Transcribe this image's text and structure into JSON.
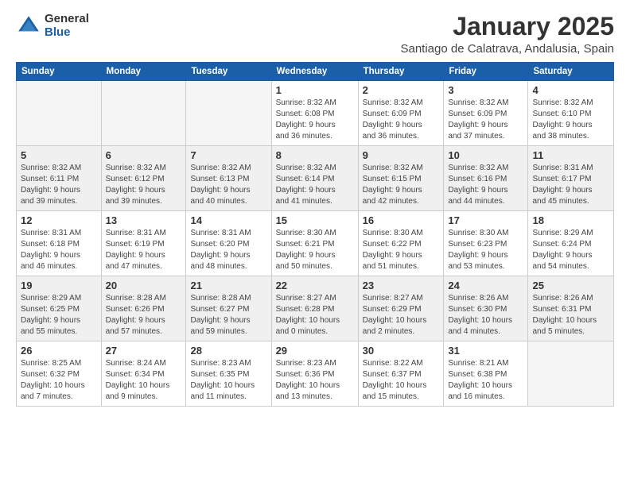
{
  "logo": {
    "general": "General",
    "blue": "Blue"
  },
  "title": "January 2025",
  "subtitle": "Santiago de Calatrava, Andalusia, Spain",
  "days_of_week": [
    "Sunday",
    "Monday",
    "Tuesday",
    "Wednesday",
    "Thursday",
    "Friday",
    "Saturday"
  ],
  "weeks": [
    [
      {
        "num": "",
        "info": "",
        "empty": true
      },
      {
        "num": "",
        "info": "",
        "empty": true
      },
      {
        "num": "",
        "info": "",
        "empty": true
      },
      {
        "num": "1",
        "info": "Sunrise: 8:32 AM\nSunset: 6:08 PM\nDaylight: 9 hours\nand 36 minutes.",
        "empty": false
      },
      {
        "num": "2",
        "info": "Sunrise: 8:32 AM\nSunset: 6:09 PM\nDaylight: 9 hours\nand 36 minutes.",
        "empty": false
      },
      {
        "num": "3",
        "info": "Sunrise: 8:32 AM\nSunset: 6:09 PM\nDaylight: 9 hours\nand 37 minutes.",
        "empty": false
      },
      {
        "num": "4",
        "info": "Sunrise: 8:32 AM\nSunset: 6:10 PM\nDaylight: 9 hours\nand 38 minutes.",
        "empty": false
      }
    ],
    [
      {
        "num": "5",
        "info": "Sunrise: 8:32 AM\nSunset: 6:11 PM\nDaylight: 9 hours\nand 39 minutes.",
        "empty": false
      },
      {
        "num": "6",
        "info": "Sunrise: 8:32 AM\nSunset: 6:12 PM\nDaylight: 9 hours\nand 39 minutes.",
        "empty": false
      },
      {
        "num": "7",
        "info": "Sunrise: 8:32 AM\nSunset: 6:13 PM\nDaylight: 9 hours\nand 40 minutes.",
        "empty": false
      },
      {
        "num": "8",
        "info": "Sunrise: 8:32 AM\nSunset: 6:14 PM\nDaylight: 9 hours\nand 41 minutes.",
        "empty": false
      },
      {
        "num": "9",
        "info": "Sunrise: 8:32 AM\nSunset: 6:15 PM\nDaylight: 9 hours\nand 42 minutes.",
        "empty": false
      },
      {
        "num": "10",
        "info": "Sunrise: 8:32 AM\nSunset: 6:16 PM\nDaylight: 9 hours\nand 44 minutes.",
        "empty": false
      },
      {
        "num": "11",
        "info": "Sunrise: 8:31 AM\nSunset: 6:17 PM\nDaylight: 9 hours\nand 45 minutes.",
        "empty": false
      }
    ],
    [
      {
        "num": "12",
        "info": "Sunrise: 8:31 AM\nSunset: 6:18 PM\nDaylight: 9 hours\nand 46 minutes.",
        "empty": false
      },
      {
        "num": "13",
        "info": "Sunrise: 8:31 AM\nSunset: 6:19 PM\nDaylight: 9 hours\nand 47 minutes.",
        "empty": false
      },
      {
        "num": "14",
        "info": "Sunrise: 8:31 AM\nSunset: 6:20 PM\nDaylight: 9 hours\nand 48 minutes.",
        "empty": false
      },
      {
        "num": "15",
        "info": "Sunrise: 8:30 AM\nSunset: 6:21 PM\nDaylight: 9 hours\nand 50 minutes.",
        "empty": false
      },
      {
        "num": "16",
        "info": "Sunrise: 8:30 AM\nSunset: 6:22 PM\nDaylight: 9 hours\nand 51 minutes.",
        "empty": false
      },
      {
        "num": "17",
        "info": "Sunrise: 8:30 AM\nSunset: 6:23 PM\nDaylight: 9 hours\nand 53 minutes.",
        "empty": false
      },
      {
        "num": "18",
        "info": "Sunrise: 8:29 AM\nSunset: 6:24 PM\nDaylight: 9 hours\nand 54 minutes.",
        "empty": false
      }
    ],
    [
      {
        "num": "19",
        "info": "Sunrise: 8:29 AM\nSunset: 6:25 PM\nDaylight: 9 hours\nand 55 minutes.",
        "empty": false
      },
      {
        "num": "20",
        "info": "Sunrise: 8:28 AM\nSunset: 6:26 PM\nDaylight: 9 hours\nand 57 minutes.",
        "empty": false
      },
      {
        "num": "21",
        "info": "Sunrise: 8:28 AM\nSunset: 6:27 PM\nDaylight: 9 hours\nand 59 minutes.",
        "empty": false
      },
      {
        "num": "22",
        "info": "Sunrise: 8:27 AM\nSunset: 6:28 PM\nDaylight: 10 hours\nand 0 minutes.",
        "empty": false
      },
      {
        "num": "23",
        "info": "Sunrise: 8:27 AM\nSunset: 6:29 PM\nDaylight: 10 hours\nand 2 minutes.",
        "empty": false
      },
      {
        "num": "24",
        "info": "Sunrise: 8:26 AM\nSunset: 6:30 PM\nDaylight: 10 hours\nand 4 minutes.",
        "empty": false
      },
      {
        "num": "25",
        "info": "Sunrise: 8:26 AM\nSunset: 6:31 PM\nDaylight: 10 hours\nand 5 minutes.",
        "empty": false
      }
    ],
    [
      {
        "num": "26",
        "info": "Sunrise: 8:25 AM\nSunset: 6:32 PM\nDaylight: 10 hours\nand 7 minutes.",
        "empty": false
      },
      {
        "num": "27",
        "info": "Sunrise: 8:24 AM\nSunset: 6:34 PM\nDaylight: 10 hours\nand 9 minutes.",
        "empty": false
      },
      {
        "num": "28",
        "info": "Sunrise: 8:23 AM\nSunset: 6:35 PM\nDaylight: 10 hours\nand 11 minutes.",
        "empty": false
      },
      {
        "num": "29",
        "info": "Sunrise: 8:23 AM\nSunset: 6:36 PM\nDaylight: 10 hours\nand 13 minutes.",
        "empty": false
      },
      {
        "num": "30",
        "info": "Sunrise: 8:22 AM\nSunset: 6:37 PM\nDaylight: 10 hours\nand 15 minutes.",
        "empty": false
      },
      {
        "num": "31",
        "info": "Sunrise: 8:21 AM\nSunset: 6:38 PM\nDaylight: 10 hours\nand 16 minutes.",
        "empty": false
      },
      {
        "num": "",
        "info": "",
        "empty": true
      }
    ]
  ]
}
